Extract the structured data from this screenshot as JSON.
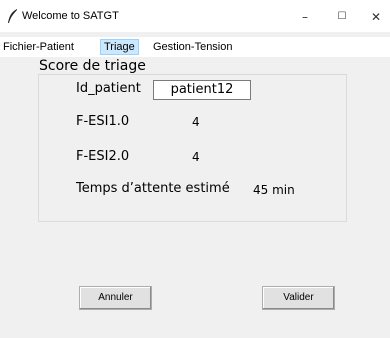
{
  "window": {
    "title": "Welcome to SATGT",
    "minimize_glyph": "–",
    "maximize_glyph": "☐",
    "close_glyph": "✕",
    "icon": "feather-icon"
  },
  "menubar": {
    "items": [
      {
        "label": "Fichier-Patient"
      },
      {
        "label": "Triage"
      },
      {
        "label": "Gestion-Tension"
      }
    ],
    "active": "Triage"
  },
  "score": {
    "title": "Score de triage",
    "id_label": "Id_patient",
    "id_value": "patient12",
    "esi1_label": "F-ESI1.0",
    "esi1_value": "4",
    "esi2_label": "F-ESI2.0",
    "esi2_value": "4",
    "wait_label": "Temps d’attente estimé",
    "wait_value": "45 min"
  },
  "actions": {
    "cancel_label": "Annuler",
    "submit_label": "Valider"
  },
  "colors": {
    "window_bg": "#f0f0f0",
    "menu_active_bg": "#cce8ff",
    "button_bg": "#e1e1e1"
  }
}
